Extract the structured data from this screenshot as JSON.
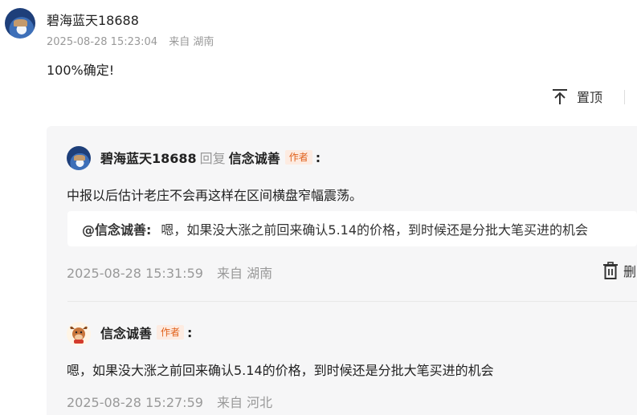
{
  "top_comment": {
    "username": "碧海蓝天18688",
    "timestamp": "2025-08-28 15:23:04",
    "location": "来自 湖南",
    "content": "100%确定!",
    "pin_label": "置顶",
    "pin_icon": "pin-top-icon"
  },
  "replies": [
    {
      "username": "碧海蓝天18688",
      "reply_word": "回复",
      "reply_target": "信念诚善",
      "author_badge": "作者",
      "colon": ":",
      "content": "中报以后估计老庄不会再这样在区间横盘窄幅震荡。",
      "quote": {
        "name": "@信念诚善:",
        "text": "嗯，如果没大涨之前回来确认5.14的价格，到时候还是分批大笔买进的机会"
      },
      "timestamp": "2025-08-28 15:31:59",
      "location": "来自 湖南",
      "delete_label": "删",
      "delete_icon": "trash-icon"
    },
    {
      "username": "信念诚善",
      "author_badge": "作者",
      "colon": ":",
      "content": "嗯，如果没大涨之前回来确认5.14的价格，到时候还是分批大笔买进的机会",
      "timestamp": "2025-08-28 15:27:59",
      "location": "来自 河北"
    }
  ],
  "colors": {
    "author_badge_text": "#e0601a",
    "author_badge_bg": "#fdebe1",
    "panel_bg": "#f6f6f7",
    "meta_text": "#999999"
  }
}
